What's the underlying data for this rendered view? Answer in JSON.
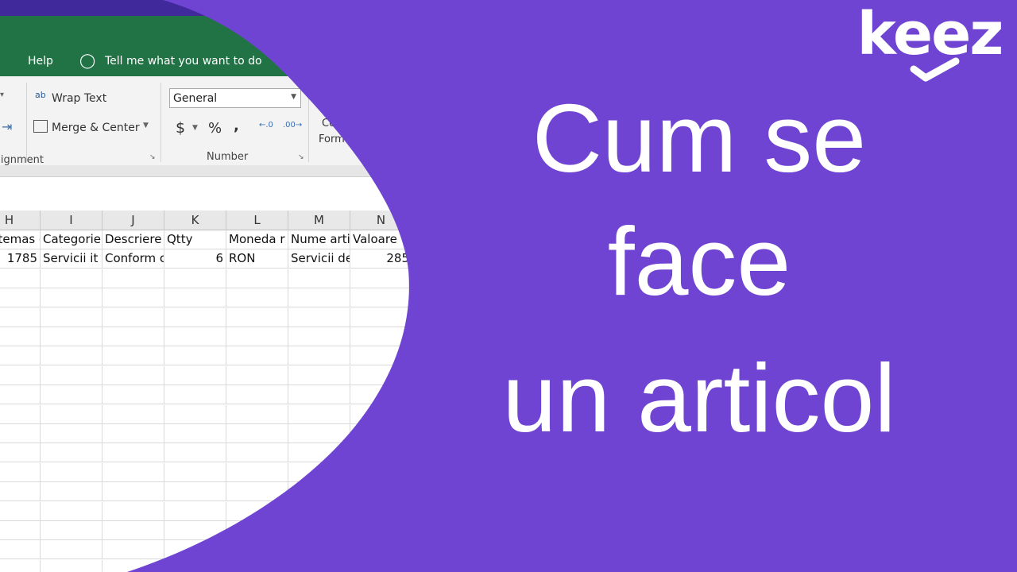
{
  "colors": {
    "background": "#6f44d3",
    "excel_green": "#217346",
    "top_band": "#40299b"
  },
  "ribbon": {
    "menu_items": [
      "Help"
    ],
    "tell_me": "Tell me what you want to do",
    "wrap_text": "Wrap Text",
    "merge_center": "Merge & Center",
    "number_format": "General",
    "currency": "$",
    "percent": "%",
    "comma": ",",
    "conditional_format_partial": [
      "Con",
      "Format"
    ],
    "groups": {
      "alignment": "Alignment",
      "number": "Number"
    }
  },
  "sheet": {
    "columns": [
      "H",
      "I",
      "J",
      "K",
      "L",
      "M",
      "N"
    ],
    "rows": [
      [
        "Sistemas de",
        "Categorie",
        "Descriere",
        "Qtty",
        "Moneda r",
        "Nume arti",
        "Valoare"
      ],
      [
        "1785",
        "Servicii it",
        "Conform c",
        "6",
        "RON",
        "Servicii de",
        "285"
      ]
    ]
  },
  "headline": {
    "line1": "Cum se",
    "line2": "face",
    "line3": "un articol"
  },
  "logo": {
    "text": "keez"
  }
}
